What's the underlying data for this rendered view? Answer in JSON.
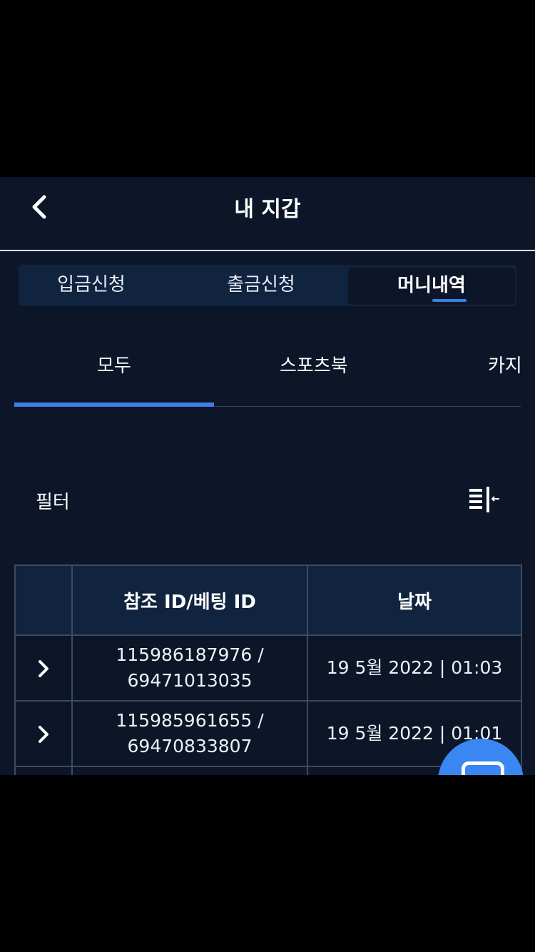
{
  "header": {
    "title": "내 지갑"
  },
  "wallet_tabs": [
    {
      "label": "입금신청"
    },
    {
      "label": "출금신청"
    },
    {
      "label": "머니내역"
    }
  ],
  "sub_tabs": [
    {
      "label": "모두"
    },
    {
      "label": "스포츠북"
    },
    {
      "label": "카지"
    }
  ],
  "filter": {
    "label": "필터"
  },
  "table": {
    "headers": [
      "",
      "참조 ID/베팅 ID",
      "날짜"
    ],
    "rows": [
      {
        "ref_id": "115986187976 /",
        "bet_id": "69471013035",
        "date": "19 5월 2022 | 01:03"
      },
      {
        "ref_id": "115985961655 /",
        "bet_id": "69470833807",
        "date": "19 5월 2022 | 01:01"
      }
    ]
  },
  "colors": {
    "background": "#0c1628",
    "panel": "#10233f",
    "accent": "#3d7fe6",
    "fab": "#3a86f2"
  },
  "icons": {
    "back": "chevron-left-icon",
    "filter": "filter-collapse-icon",
    "row": "chevron-right-icon",
    "fab": "chat-icon"
  }
}
